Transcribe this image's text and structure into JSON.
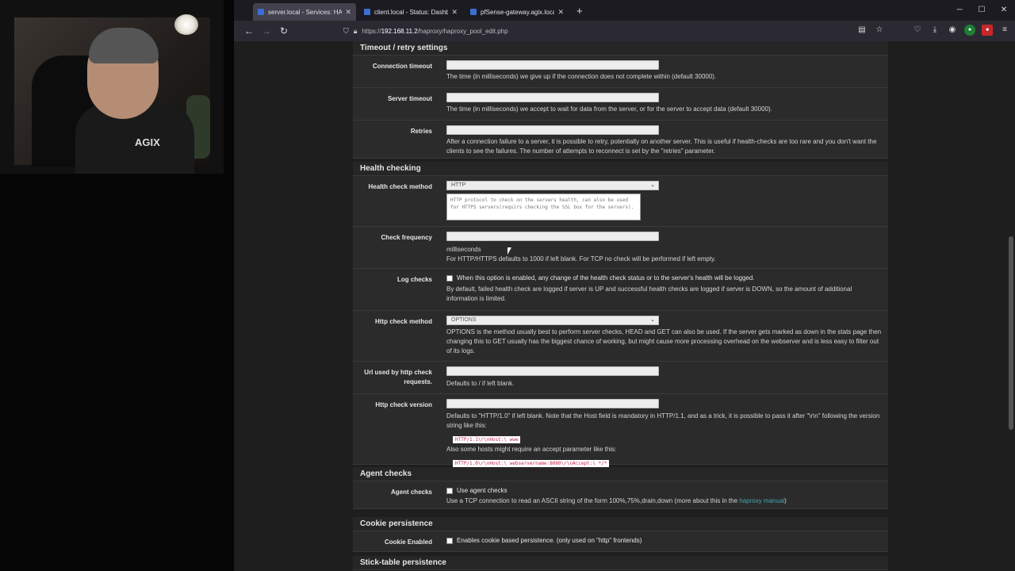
{
  "webcam": {
    "shirt_logo": "AGIX"
  },
  "tabs": [
    {
      "label": "server.local - Services: HAProxy",
      "active": true
    },
    {
      "label": "client.local - Status: Dashboard",
      "active": false
    },
    {
      "label": "pfSense-gateway.agix.local - St",
      "active": false
    }
  ],
  "url": {
    "prefix": "https://",
    "host": "192.168.11.2",
    "path": "/haproxy/haproxy_pool_edit.php"
  },
  "timeout": {
    "title": "Timeout / retry settings",
    "connection_label": "Connection timeout",
    "connection_help": "The time (in milliseconds) we give up if the connection does not complete within (default 30000).",
    "server_label": "Server timeout",
    "server_help": "The time (in milliseconds) we accept to wait for data from the server, or for the server to accept data (default 30000).",
    "retries_label": "Retries",
    "retries_help": "After a connection failure to a server, it is possible to retry, potentially on another server. This is useful if health-checks are too rare and you don't want the clients to see the failures. The number of attempts to reconnect is set by the \"retries\" parameter."
  },
  "health": {
    "title": "Health checking",
    "method_label": "Health check method",
    "method_value": "HTTP",
    "method_desc": "HTTP protocol to check on the servers health, can also be used for HTTPS servers(requirs checking the SSL box for the servers).",
    "freq_label": "Check frequency",
    "freq_unit": "milliseconds",
    "freq_help": "For HTTP/HTTPS defaults to 1000 if left blank. For TCP no check will be performed if left empty.",
    "log_label": "Log checks",
    "log_check_text": "When this option is enabled, any change of the health check status or to the server's health will be logged.",
    "log_help": "By default, failed health check are logged if server is UP and successful health checks are logged if server is DOWN, so the amount of additional information is limited.",
    "http_method_label": "Http check method",
    "http_method_value": "OPTIONS",
    "http_method_help": "OPTIONS is the method usually best to perform server checks, HEAD and GET can also be used. If the server gets marked as down in the stats page then changing this to GET usually has the biggest chance of working, but might cause more processing overhead on the webserver and is less easy to filter out of its logs.",
    "url_label": "Url used by http check requests.",
    "url_help": "Defaults to / if left blank.",
    "version_label": "Http check version",
    "version_help": "Defaults to \"HTTP/1.0\" if left blank. Note that the Host field is mandatory in HTTP/1.1, and as a trick, it is possible to pass it after \"\\r\\n\" following the version string like this:",
    "version_code1": "HTTP/1.1\\r\\nHost:\\ www",
    "version_help2": "Also some hosts might require an accept parameter like this:",
    "version_code2": "HTTP/1.0\\r\\nHost:\\ webservername:8080\\r\\nAccept:\\ */*"
  },
  "agent": {
    "title": "Agent checks",
    "label": "Agent checks",
    "check_text": "Use agent checks",
    "help_pre": "Use a TCP connection to read an ASCII string of the form 100%,75%,drain,down (more about this in the ",
    "help_link": "haproxy manual",
    "help_post": ")"
  },
  "cookie": {
    "title": "Cookie persistence",
    "label": "Cookie Enabled",
    "check_text": "Enables cookie based persistence. (only used on \"http\" frontends)"
  },
  "stick": {
    "title": "Stick-table persistence"
  }
}
